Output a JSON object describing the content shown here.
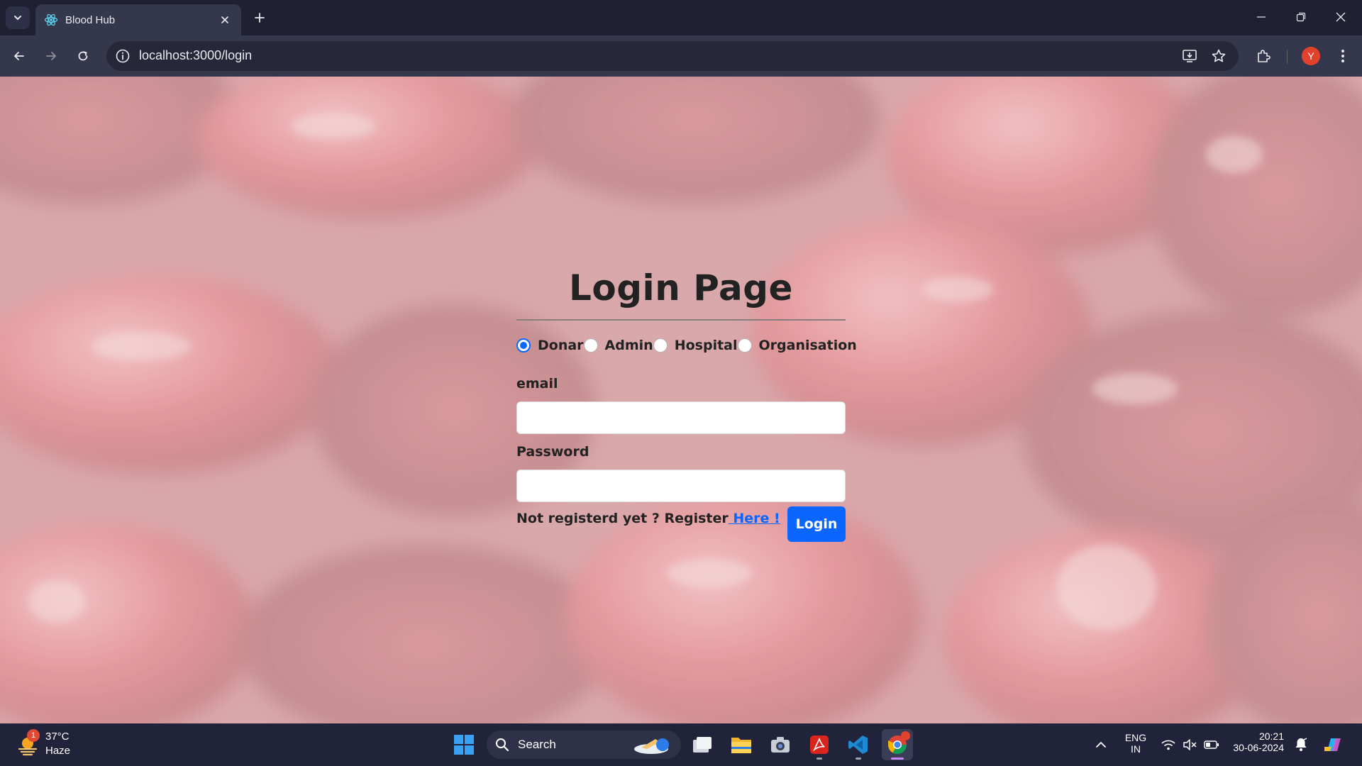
{
  "browser": {
    "tab_title": "Blood Hub",
    "url": "localhost:3000/login",
    "profile_initial": "Y"
  },
  "login": {
    "title": "Login Page",
    "roles": [
      {
        "label": "Donar",
        "checked": true
      },
      {
        "label": "Admin",
        "checked": false
      },
      {
        "label": "Hospital",
        "checked": false
      },
      {
        "label": "Organisation",
        "checked": false
      }
    ],
    "email_label": "email",
    "email_value": "",
    "password_label": "Password",
    "password_value": "",
    "register_prompt": "Not registerd yet ? Register",
    "register_link": " Here !",
    "login_button": "Login"
  },
  "taskbar": {
    "weather_temp": "37°C",
    "weather_condition": "Haze",
    "weather_badge": "1",
    "search_placeholder": "Search",
    "language_top": "ENG",
    "language_bottom": "IN",
    "time": "20:21",
    "date": "30-06-2024"
  },
  "colors": {
    "accent": "#0b66ff",
    "chrome_dark": "#1f2133",
    "chrome_toolbar": "#35384c"
  }
}
